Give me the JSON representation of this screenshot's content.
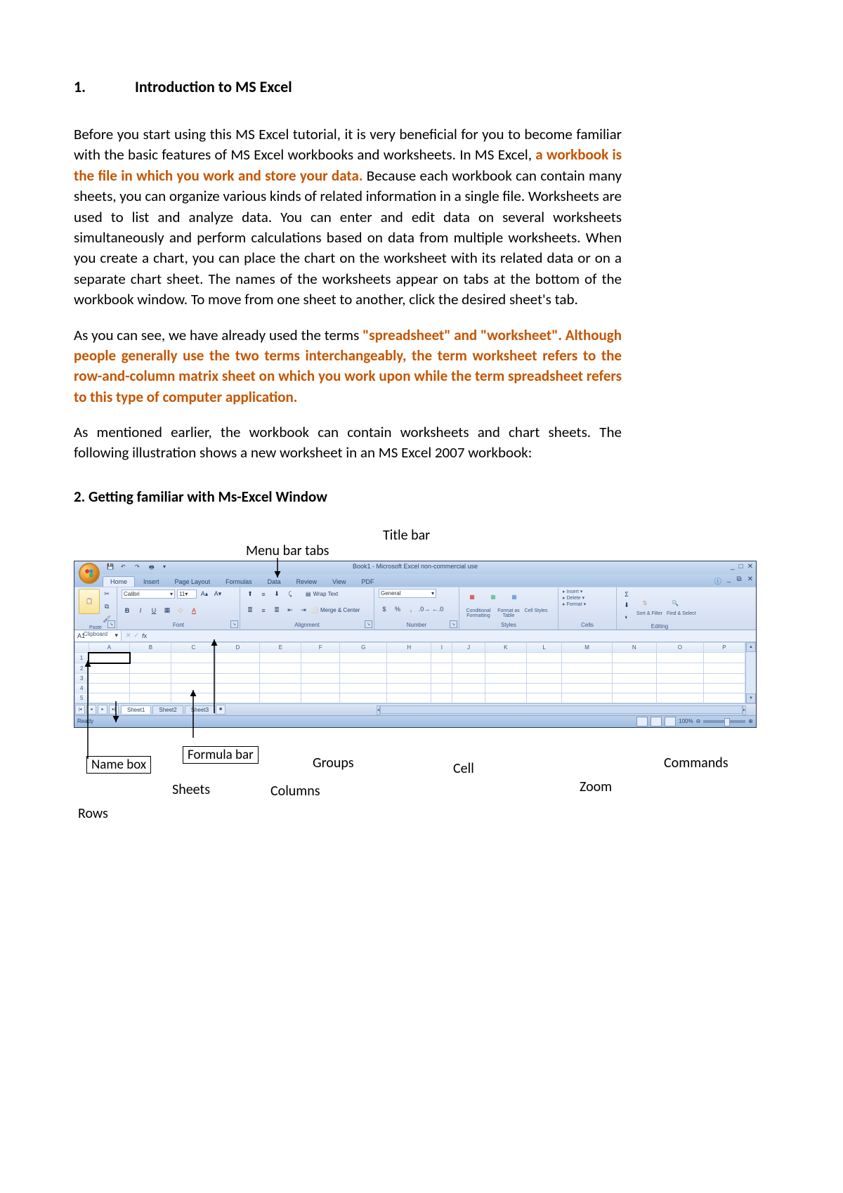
{
  "section1": {
    "number": "1.",
    "title": "Introduction to MS Excel"
  },
  "para1_pre": "Before you start using this MS Excel tutorial, it is very beneficial for you to become familiar with the basic features of MS Excel workbooks and worksheets.  In MS Excel, ",
  "para1_highlight": "a workbook is the file in which you work and store your data.",
  "para1_post": "  Because each workbook can contain many sheets, you can organize various kinds of related information in a single file.  Worksheets are used to list and analyze data. You can enter and edit data on several worksheets simultaneously and perform calculations based on data from multiple worksheets.  When you create a chart, you can place the chart on the worksheet with its related data or on a separate chart sheet.  The names of the worksheets appear on tabs at the bottom of the workbook window.  To move from one sheet to another, click the desired sheet's tab.",
  "para2_pre": "As you can see, we have already used the terms ",
  "para2_h1": "\"spreadsheet\" and \"worksheet\". Although people generally use the two terms interchangeably, the term worksheet refers to the row-and-column matrix sheet on which you work upon while the term spreadsheet refers to this type of computer application.",
  "para3": "As mentioned earlier, the workbook can contain worksheets and chart sheets.  The following illustration shows a new worksheet in an MS Excel 2007 workbook:",
  "section2": {
    "text": "2.   Getting familiar with Ms-Excel Window"
  },
  "labels": {
    "title_bar": "Title bar",
    "menu_tabs": "Menu bar tabs",
    "name_box": "Name box",
    "formula_bar": "Formula bar",
    "groups": "Groups",
    "cell": "Cell",
    "commands": "Commands",
    "sheets": "Sheets",
    "columns": "Columns",
    "zoom": "Zoom",
    "rows": "Rows"
  },
  "excel": {
    "win_title": "Book1 - Microsoft Excel non-commercial use",
    "tabs": [
      "Home",
      "Insert",
      "Page Layout",
      "Formulas",
      "Data",
      "Review",
      "View",
      "PDF"
    ],
    "font_name": "Calibri",
    "font_size": "11",
    "paste": "Paste",
    "wrap": "Wrap Text",
    "merge": "Merge & Center",
    "num_format": "General",
    "cond": "Conditional Formatting",
    "fmt_table": "Format as Table",
    "cell_styles": "Cell Styles",
    "insert": "Insert",
    "delete": "Delete",
    "format": "Format",
    "sort": "Sort & Filter",
    "find": "Find & Select",
    "groups": {
      "clipboard": "Clipboard",
      "font": "Font",
      "alignment": "Alignment",
      "number": "Number",
      "styles": "Styles",
      "cells": "Cells",
      "editing": "Editing"
    },
    "grid_cols": [
      "A",
      "B",
      "C",
      "D",
      "E",
      "F",
      "G",
      "H",
      "I",
      "J",
      "K",
      "L",
      "M",
      "N",
      "O",
      "P"
    ],
    "grid_rows": [
      "1",
      "2",
      "3",
      "4",
      "5"
    ],
    "active_cell": "A1",
    "sheet_tabs": [
      "Sheet1",
      "Sheet2",
      "Sheet3"
    ],
    "status": "Ready",
    "zoom_pct": "100%"
  }
}
